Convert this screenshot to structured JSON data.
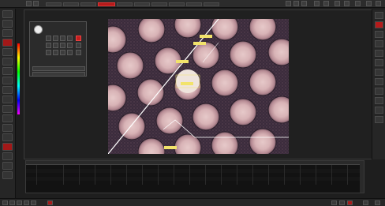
{
  "app": {
    "brand": ""
  },
  "toolbar": {
    "active_tab": "",
    "buttons": [
      "",
      "",
      "",
      "",
      "",
      "",
      "",
      "",
      "",
      "",
      ""
    ]
  },
  "camera_panel": {
    "buttons": [
      "",
      "",
      "",
      "",
      "",
      "",
      "",
      "",
      "",
      "",
      "",
      "",
      "",
      "",
      ""
    ],
    "rows": [
      "",
      ""
    ]
  },
  "annotations": [
    "",
    "",
    "",
    "",
    ""
  ],
  "table": {
    "headers": [
      "",
      "",
      "",
      "",
      "",
      "",
      "",
      "",
      "",
      "",
      "",
      "",
      "",
      "",
      "",
      "",
      "",
      "",
      "",
      "",
      ""
    ],
    "rows": [
      [
        "",
        "",
        "",
        "",
        "",
        "",
        "",
        "",
        "",
        "",
        "",
        "",
        "",
        "",
        "",
        "",
        "",
        "",
        "",
        "",
        ""
      ],
      [
        "",
        "",
        "",
        "",
        "",
        "",
        "",
        "",
        "",
        "",
        "",
        "",
        "",
        "",
        "",
        "",
        "",
        "",
        "",
        "",
        ""
      ],
      [
        "",
        "",
        "",
        "",
        "",
        "",
        "",
        "",
        "",
        "",
        "",
        "",
        "",
        "",
        "",
        "",
        "",
        "",
        "",
        "",
        ""
      ],
      [
        "",
        "",
        "",
        "",
        "",
        "",
        "",
        "",
        "",
        "",
        "",
        "",
        "",
        "",
        "",
        "",
        "",
        "",
        "",
        "",
        ""
      ],
      [
        "",
        "",
        "",
        "",
        "",
        "",
        "",
        "",
        "",
        "",
        "",
        "",
        "",
        "",
        "",
        "",
        "",
        "",
        "",
        "",
        ""
      ]
    ]
  },
  "status": {
    "left": "",
    "right": ""
  },
  "colors": {
    "accent": "#b51b1b",
    "background": "#1e1e1e",
    "overlay_line": "#ffffff",
    "annotation": "#f2e36b"
  },
  "icons": {
    "left_rail": [
      "select-icon",
      "measure-icon",
      "zoom-icon",
      "camera-icon",
      "annotate-icon",
      "settings-icon",
      "layers-icon",
      "color-icon",
      "light-icon",
      "focus-icon",
      "grid-icon",
      "ruler-icon",
      "export-icon",
      "help-icon",
      "record-icon",
      "person-icon",
      "tools-icon",
      "grid-view-icon"
    ],
    "right_rail": [
      "close-icon",
      "red-action-icon",
      "list-icon",
      "save-icon",
      "refresh-icon",
      "zoom-in-icon",
      "zoom-out-icon",
      "settings-icon",
      "info-icon",
      "delete-icon",
      "export-icon",
      "help-icon"
    ],
    "status": [
      "play-icon",
      "camera-icon",
      "video-icon",
      "settings-icon",
      "grid-icon",
      "layers-icon",
      "pause-icon",
      "record-icon",
      "zoom-icon"
    ]
  }
}
